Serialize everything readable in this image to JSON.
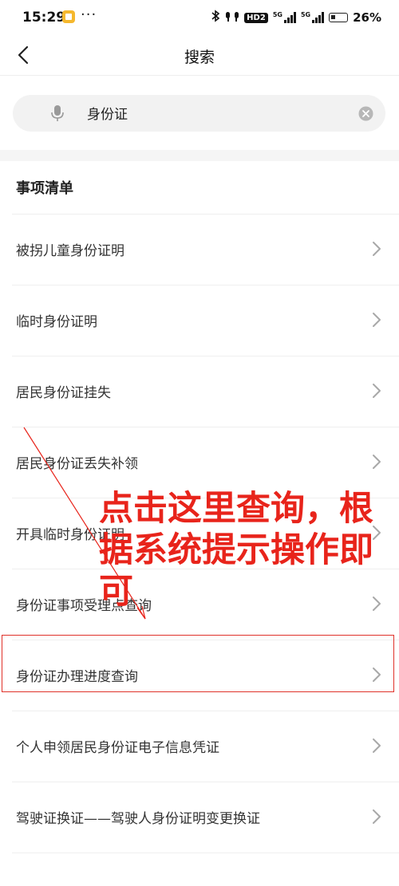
{
  "status_bar": {
    "time": "15:29",
    "more": "···",
    "hd": "HD2",
    "sig1_tag": "5G",
    "sig2_tag": "5G",
    "battery_pct": "26%"
  },
  "header": {
    "title": "搜索"
  },
  "search": {
    "value": "身份证"
  },
  "list": {
    "section_title": "事项清单",
    "items": [
      {
        "label": "被拐儿童身份证明"
      },
      {
        "label": "临时身份证明"
      },
      {
        "label": "居民身份证挂失"
      },
      {
        "label": "居民身份证丢失补领"
      },
      {
        "label": "开具临时身份证明"
      },
      {
        "label": "身份证事项受理点查询"
      },
      {
        "label": "身份证办理进度查询"
      },
      {
        "label": "个人申领居民身份证电子信息凭证"
      },
      {
        "label": "驾驶证换证——驾驶人身份证明变更换证"
      }
    ]
  },
  "annotation": {
    "text": "点击这里查询，根据系统提示操作即可",
    "color": "#e8241b"
  }
}
